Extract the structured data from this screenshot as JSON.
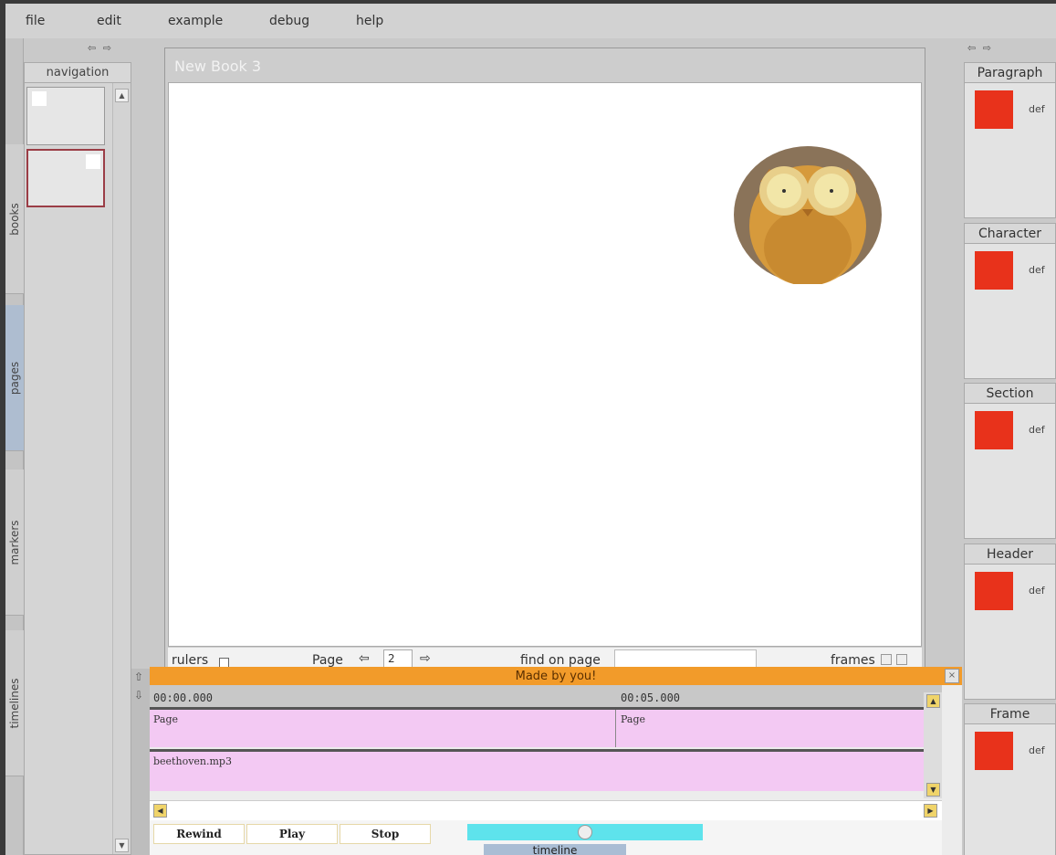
{
  "menu": [
    "file",
    "edit",
    "example",
    "debug",
    "help"
  ],
  "left_tabs": [
    "books",
    "pages",
    "markers",
    "timelines"
  ],
  "nav_panel": {
    "arrows": "⇦ ⇨",
    "title": "navigation"
  },
  "editor": {
    "title": "New Book 3",
    "footer": {
      "rulers_label": "rulers",
      "page_label": "Page",
      "page_number": "2",
      "find_label": "find on page",
      "find_value": "",
      "frames_label": "frames"
    }
  },
  "timeline": {
    "header": "Made by you!",
    "times": [
      "00:00.000",
      "00:05.000"
    ],
    "page_track": [
      "Page",
      "Page"
    ],
    "audio_track": "beethoven.mp3",
    "controls": {
      "rewind": "Rewind",
      "play": "Play",
      "stop": "Stop"
    },
    "progress": 0.5,
    "tab": "timeline"
  },
  "style_panels": [
    {
      "title": "Paragraph",
      "value": "def"
    },
    {
      "title": "Character",
      "value": "def"
    },
    {
      "title": "Section",
      "value": "def"
    },
    {
      "title": "Header",
      "value": "def"
    },
    {
      "title": "Frame",
      "value": "def"
    }
  ],
  "colors": {
    "swatch": "#e8321b",
    "timeline_header": "#f29b2a",
    "track": "#f3c9f3",
    "progress": "#5ee3ec"
  }
}
